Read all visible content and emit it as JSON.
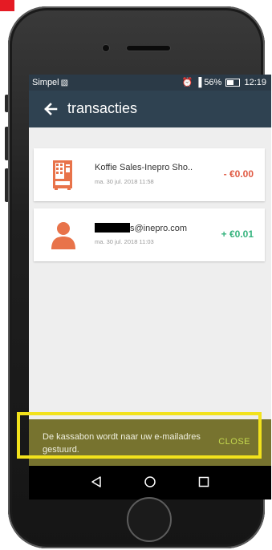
{
  "status_bar": {
    "carrier": "Simpel",
    "battery": "56%",
    "time": "12:19"
  },
  "app_bar": {
    "title": "transacties",
    "back_icon": "arrow-left-icon"
  },
  "transactions": [
    {
      "icon": "vending-machine-icon",
      "title": "Koffie Sales-Inepro Sho..",
      "date": "ma. 30 jul. 2018 11:58",
      "amount": "- €0.00",
      "type": "debit"
    },
    {
      "icon": "person-icon",
      "title": "s@inepro.com",
      "date": "ma. 30 jul. 2018 11:03",
      "amount": "+ €0.01",
      "type": "credit"
    }
  ],
  "snackbar": {
    "message": "De kassabon wordt naar uw e-mailadres gestuurd.",
    "action": "CLOSE"
  },
  "nav_bar": {
    "buttons": [
      "back-triangle-icon",
      "home-circle-icon",
      "recents-square-icon"
    ]
  },
  "colors": {
    "app_bar": "#2f4251",
    "status_bar": "#2b3a47",
    "accent_orange": "#e8734a",
    "negative": "#e05a43",
    "positive": "#35b37e",
    "snackbar": "#77732f",
    "highlight": "#f2e21c"
  }
}
